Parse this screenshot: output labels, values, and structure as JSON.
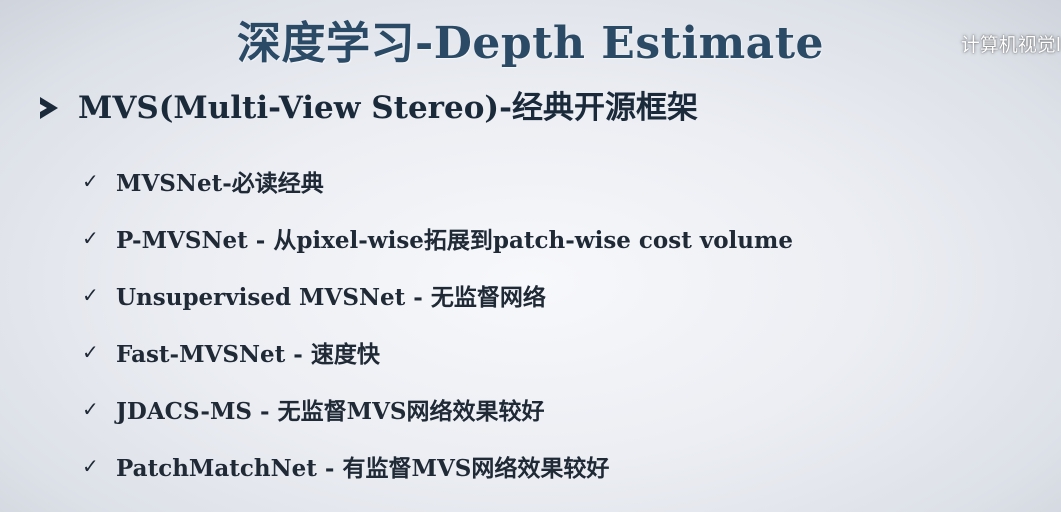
{
  "slide": {
    "title": "深度学习-Depth Estimate",
    "watermark": "计算机视觉l",
    "heading": "MVS(Multi-View Stereo)-经典开源框架",
    "heading_icon": "arrow-bullet-icon",
    "check_glyph": "✓",
    "items": [
      {
        "label": "MVSNet-必读经典"
      },
      {
        "label": "P-MVSNet - 从pixel-wise拓展到patch-wise cost volume"
      },
      {
        "label": "Unsupervised MVSNet - 无监督网络"
      },
      {
        "label": "Fast-MVSNet - 速度快"
      },
      {
        "label": "JDACS-MS - 无监督MVS网络效果较好"
      },
      {
        "label": "PatchMatchNet - 有监督MVS网络效果较好"
      }
    ]
  },
  "colors": {
    "title": "#2b4a66",
    "text": "#1f2a36",
    "background": "#eceef3"
  }
}
